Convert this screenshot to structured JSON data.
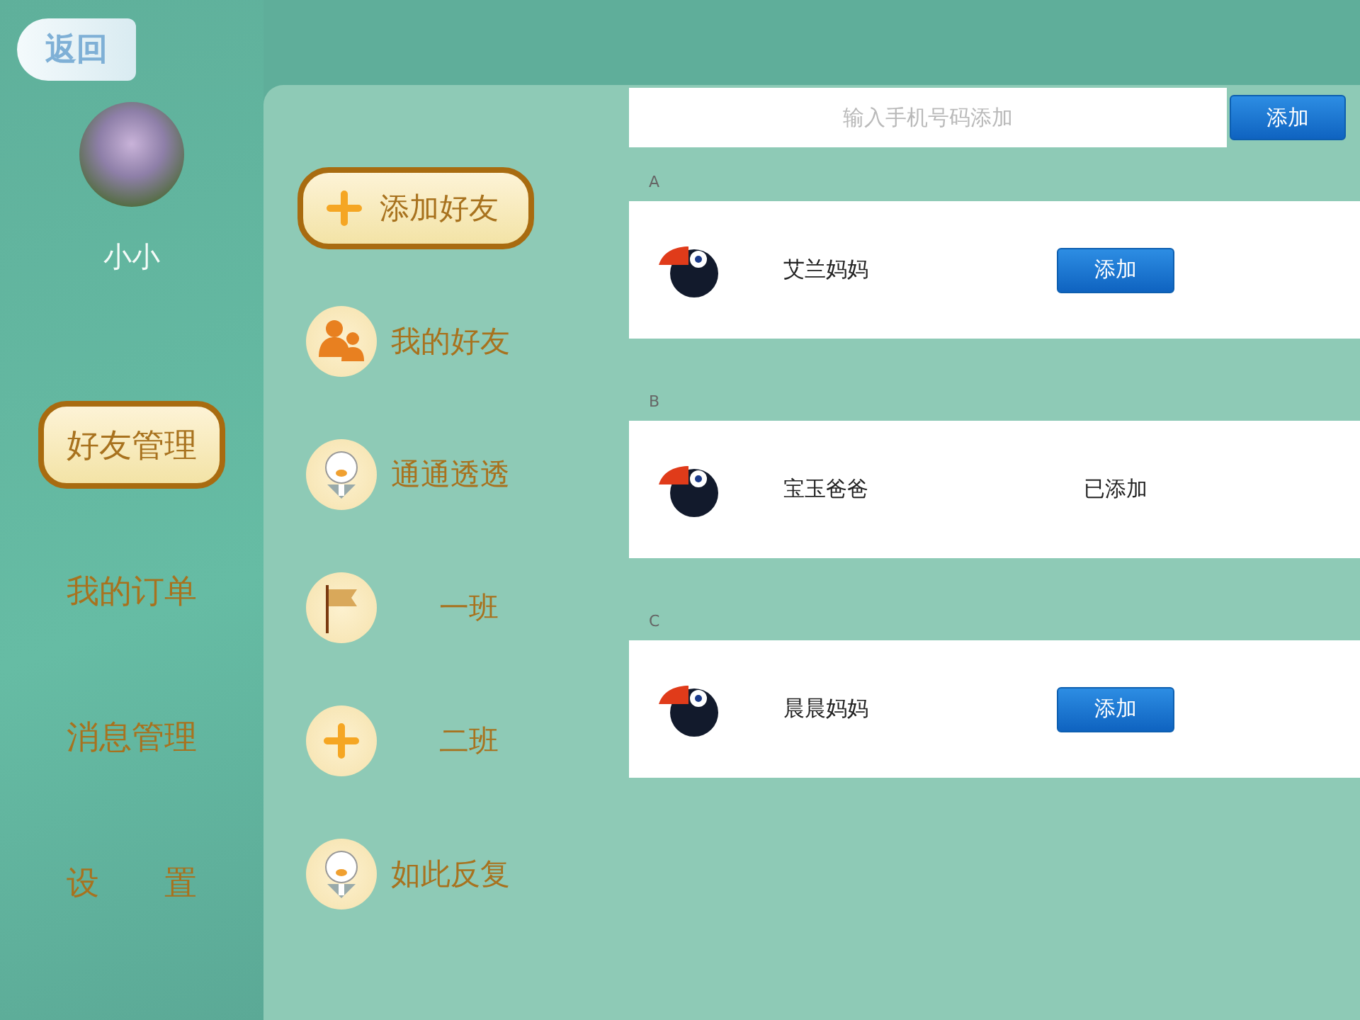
{
  "sidebar": {
    "back_button": "返回",
    "user_name": "小小",
    "menu": [
      {
        "label": "好友管理",
        "selected": true
      },
      {
        "label": "我的订单",
        "selected": false
      },
      {
        "label": "消息管理",
        "selected": false
      },
      {
        "label": "设　　置",
        "selected": false
      }
    ]
  },
  "friend_menu": [
    {
      "label": "添加好友",
      "kind": "plus",
      "selected": true
    },
    {
      "label": "我的好友",
      "kind": "people",
      "selected": false
    },
    {
      "label": "通通透透",
      "kind": "avatar",
      "selected": false
    },
    {
      "label": "一班",
      "kind": "flag",
      "selected": false
    },
    {
      "label": "二班",
      "kind": "plus",
      "selected": false
    },
    {
      "label": "如此反复",
      "kind": "avatar",
      "selected": false
    }
  ],
  "search": {
    "placeholder": "输入手机号码添加",
    "button": "添加"
  },
  "sections": [
    {
      "letter": "A",
      "name": "艾兰妈妈",
      "kind": "button",
      "action": "添加"
    },
    {
      "letter": "B",
      "name": "宝玉爸爸",
      "kind": "status",
      "action": "已添加"
    },
    {
      "letter": "C",
      "name": "晨晨妈妈",
      "kind": "button",
      "action": "添加"
    }
  ]
}
